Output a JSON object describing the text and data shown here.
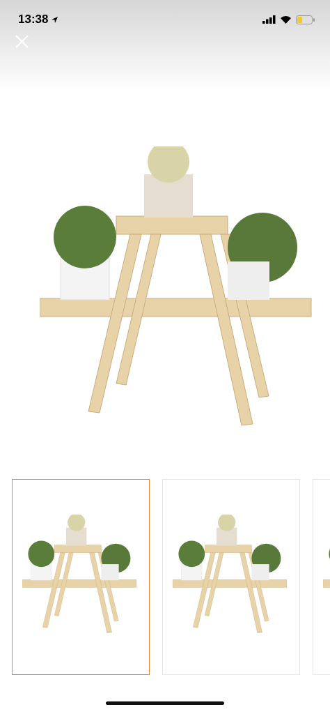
{
  "status_bar": {
    "time": "13:38"
  },
  "main_photo": {
    "kind": "photo"
  },
  "thumbnails": [
    {
      "selected": true
    },
    {
      "selected": false
    },
    {
      "selected": false
    }
  ]
}
